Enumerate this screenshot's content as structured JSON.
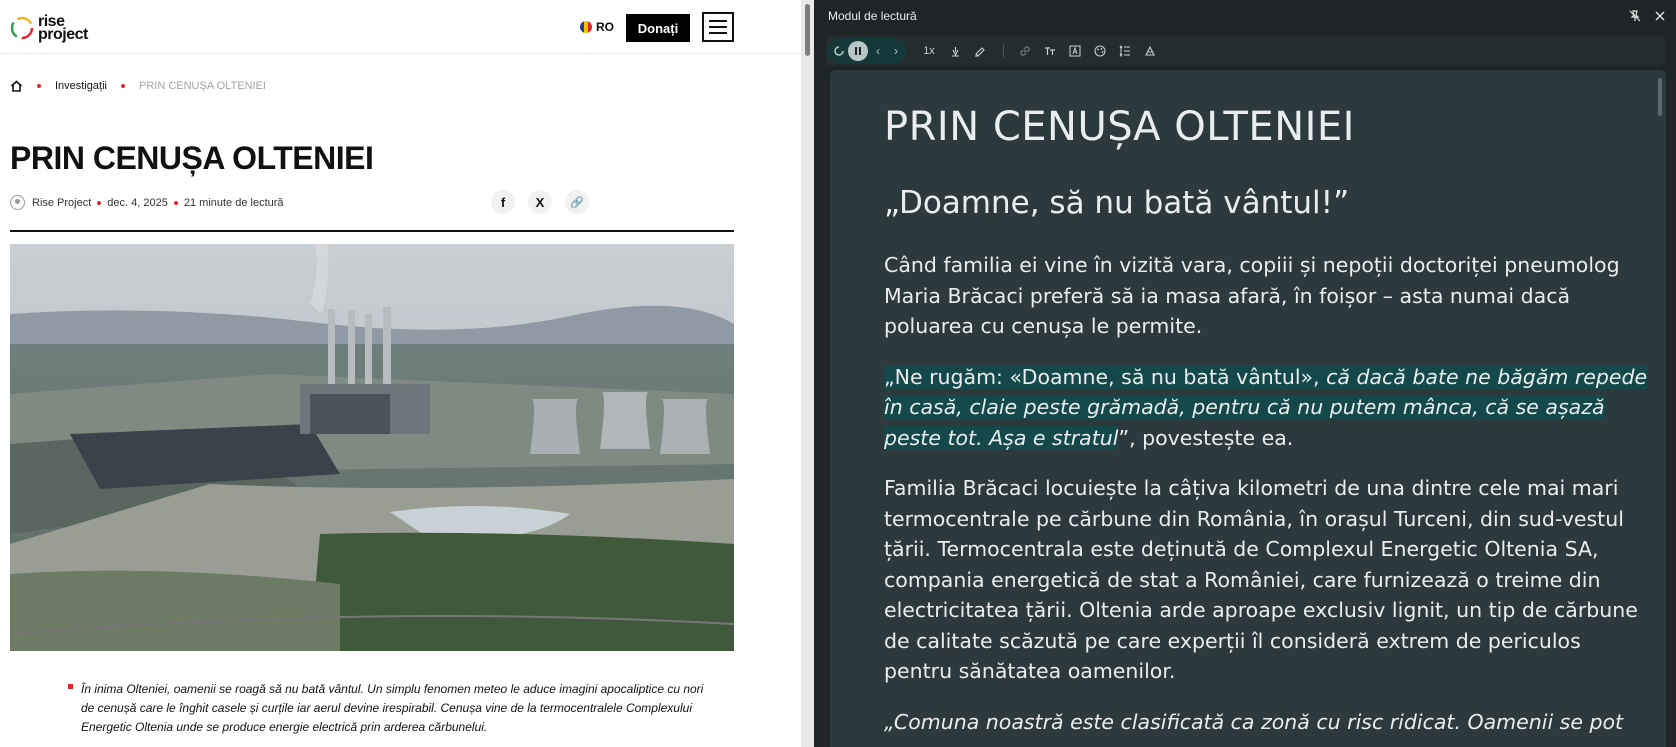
{
  "site": {
    "logo_line1": "rise",
    "logo_line2": "project",
    "language": "RO",
    "donate_label": "Donați"
  },
  "breadcrumb": {
    "section": "Investigații",
    "current": "PRIN CENUȘA OLTENIEI"
  },
  "article": {
    "title": "PRIN CENUȘA OLTENIEI",
    "author": "Rise Project",
    "date": "dec. 4, 2025",
    "read_time": "21 minute de lectură",
    "share": {
      "facebook": "f",
      "x": "X",
      "link": "🔗"
    },
    "lead": "În inima Olteniei, oamenii se roagă să nu bată vântul. Un simplu fenomen meteo le aduce imagini apocaliptice cu nori de cenușă care le înghit casele și curțile iar aerul devine irespirabil. Cenușa vine de la termocentralele Complexului Energetic Oltenia unde se produce energie electrică prin arderea cărbunelui."
  },
  "reader": {
    "panel_title": "Modul de lectură",
    "speed": "1x",
    "title": "PRIN CENUȘA OLTENIEI",
    "subtitle": "„Doamne, să nu bată vântul!”",
    "p1": "Când familia ei vine în vizită vara, copiii și nepoții doctoriței pneumolog Maria Brăcaci preferă să ia masa afară, în foișor – asta numai dacă poluarea cu cenușa le permite.",
    "p2_a": "„Ne rugăm: «Doamne, să nu bată vântul», ",
    "p2_b": "că dacă bate ne băgăm repede în casă, claie peste grămadă, pentru că nu putem mânca, că se așază peste tot. Așa e stratul",
    "p2_c": "”, povestește ea.",
    "p3": "Familia Brăcaci locuiește la câțiva kilometri de una dintre cele mai mari termocentrale pe cărbune din România, în orașul Turceni, din sud-vestul țării. Termocentrala este deținută de Complexul Energetic Oltenia SA, compania energetică de stat a României, care furnizează o treime din electricitatea țării. Oltenia arde aproape exclusiv lignit, un tip de cărbune de calitate scăzută pe care experții îl consideră extrem de periculos pentru sănătatea oamenilor.",
    "p4": "„Comuna noastră este clasificată ca zonă cu risc ridicat. Oamenii se pot"
  },
  "colors": {
    "accent_red": "#e3262b",
    "reader_bg": "#2c3a3e",
    "reader_highlight": "#15484a"
  }
}
